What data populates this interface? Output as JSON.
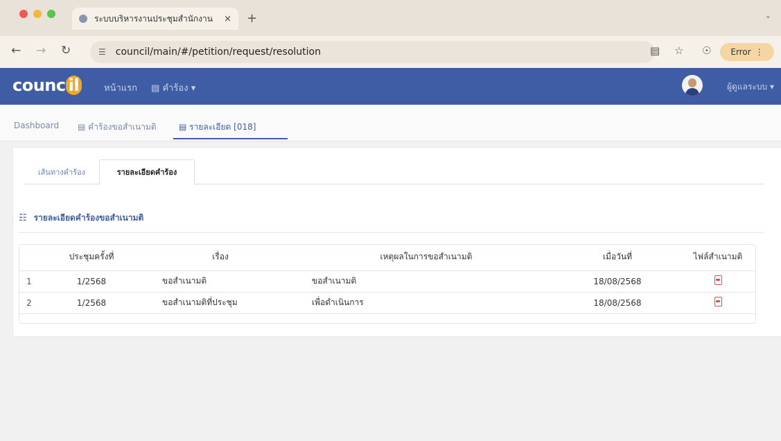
{
  "browser": {
    "tab_title": "ระบบบริหารงานประชุมสำนักงาน",
    "tab_close": "×",
    "new_tab": "+",
    "url": "council/main/#/petition/request/resolution",
    "error_label": "Error"
  },
  "navbar": {
    "logo_main": "counc",
    "logo_accent": "il",
    "home": "หน้าแรก",
    "requests": "คำร้อง",
    "user": "ผู้ดูแลระบบ"
  },
  "breadcrumb": {
    "items": [
      {
        "label": "Dashboard"
      },
      {
        "label": "คำร้องขอสำเนามติ"
      },
      {
        "label": "รายละเอียด [018]"
      }
    ]
  },
  "content_tabs": [
    {
      "label": "เส้นทางคำร้อง"
    },
    {
      "label": "รายละเอียดคำร้อง"
    }
  ],
  "section_title": "รายละเอียดคำร้องขอสำเนามติ",
  "table": {
    "headers": {
      "meeting": "ประชุมครั้งที่",
      "subject": "เรื่อง",
      "reason": "เหตุผลในการขอสำเนามติ",
      "date": "เมื่อวันที่",
      "file": "ไฟล์สำเนามติ"
    },
    "rows": [
      {
        "no": "1",
        "meeting": "1/2568",
        "subject": "ขอสำเนามติ",
        "reason": "ขอสำเนามติ",
        "date": "18/08/2568"
      },
      {
        "no": "2",
        "meeting": "1/2568",
        "subject": "ขอสำเนามติที่ประชุม",
        "reason": "เพื่อดำเนินการ",
        "date": "18/08/2568"
      }
    ]
  },
  "colors": {
    "navbar": "#3f5da4",
    "logo_accent": "#f1a628",
    "pdf_icon": "#e44a4a"
  }
}
